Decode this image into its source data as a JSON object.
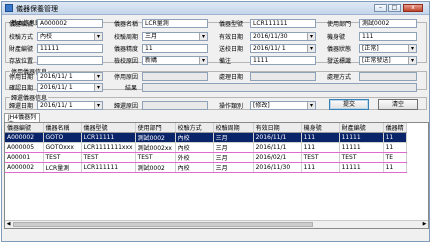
{
  "window": {
    "title": "儀器保養管理"
  },
  "basic": {
    "title": "基本信息錄入",
    "labels": {
      "code": "儀器編號",
      "name": "儀器名稱",
      "model": "儀器型號",
      "dept": "使用部門",
      "method": "校驗方式",
      "cycle": "校驗周期",
      "valid": "有效日期",
      "owner": "機身號",
      "asset": "財產編號",
      "precision": "儀器精度",
      "last": "送校日期",
      "status": "儀器狀態",
      "store": "存放位置",
      "reason": "檢校原因",
      "remark": "備注",
      "mark": "發送標識"
    },
    "values": {
      "code": "A000002",
      "name": "LCR量測",
      "model": "LCR111111",
      "dept": "測試0002",
      "method": "內校",
      "cycle": "三月",
      "valid": "2016/11/30",
      "owner": "111",
      "asset": "11111",
      "precision": "11",
      "last": "2016/11/ 1",
      "status": "[正常]",
      "store": "",
      "reason": "新購",
      "remark": "1111",
      "mark": "[正常發送]"
    }
  },
  "stop": {
    "title": "停用儀器信息",
    "labels": {
      "stop_date": "停用日期",
      "stop_reason": "停用原因",
      "handle_date": "處理日期",
      "handle_method": "處理方式",
      "confirm_date": "確認日期",
      "result": "結果"
    },
    "values": {
      "stop_date": "2016/11/ 1",
      "confirm_date": "2016/11/ 1"
    }
  },
  "borrow": {
    "title": "歸還儀器信息",
    "labels": {
      "borrow_date": "歸還日期",
      "borrow_reason": "歸還原因",
      "operate": "操作類別"
    },
    "values": {
      "borrow_date": "2016/11/ 1",
      "operate": "[修改]"
    }
  },
  "buttons": {
    "submit": "提交",
    "clear": "清空"
  },
  "tab": {
    "label": "JH4儀器列表"
  },
  "table": {
    "headers": [
      "儀器編號",
      "儀器名稱",
      "儀器型號",
      "使用部門",
      "校驗方式",
      "校驗周期",
      "有效日期",
      "機身號",
      "財產編號",
      "儀器精"
    ],
    "rows": [
      [
        "A000002",
        "GOTO",
        "LCR11111",
        "測試0002",
        "內校",
        "三月",
        "2016/11/1",
        "111",
        "11111",
        "11"
      ],
      [
        "A000005",
        "GOTOxxx",
        "LCR1111111xxx",
        "測試0002xx",
        "內校",
        "三月",
        "2016/11/1",
        "111",
        "11111",
        "11"
      ],
      [
        "A00001",
        "TEST",
        "TEST",
        "TEST",
        "外校",
        "三月",
        "2016/02/1",
        "TEST",
        "TEST",
        "TE"
      ],
      [
        "A000002",
        "LCR量測",
        "LCR111111",
        "測試0002",
        "內校",
        "三月",
        "2016/11/30",
        "111",
        "11111",
        "11"
      ]
    ]
  }
}
